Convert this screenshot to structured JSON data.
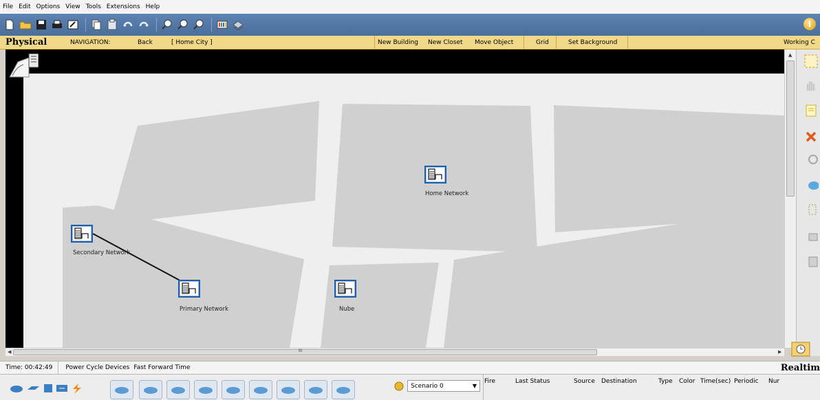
{
  "menu": [
    "File",
    "Edit",
    "Options",
    "View",
    "Tools",
    "Extensions",
    "Help"
  ],
  "nav": {
    "title": "Physical",
    "navigation_label": "NAVIGATION:",
    "back": "Back",
    "location": "[ Home City ]",
    "new_building": "New Building",
    "new_closet": "New Closet",
    "move_object": "Move Object",
    "grid": "Grid",
    "set_background": "Set Background",
    "working": "Working C"
  },
  "devices": [
    {
      "label": "Home Network"
    },
    {
      "label": "Secondary Network"
    },
    {
      "label": "Primary Network"
    },
    {
      "label": "Nube"
    }
  ],
  "hscroll_grip": "III",
  "status": {
    "time": "Time: 00:42:49",
    "power_cycle": "Power Cycle Devices",
    "fast_forward": "Fast Forward Time",
    "mode": "Realtim"
  },
  "scenario": {
    "value": "Scenario 0"
  },
  "pdu_columns": [
    "Fire",
    "Last Status",
    "Source",
    "Destination",
    "Type",
    "Color",
    "Time(sec)",
    "Periodic",
    "Nur"
  ],
  "colors": {
    "toolbar": "#4b6e9a",
    "nav": "#f2d98a",
    "device_border": "#1f5fa8",
    "ground": "#d0d0d0"
  }
}
